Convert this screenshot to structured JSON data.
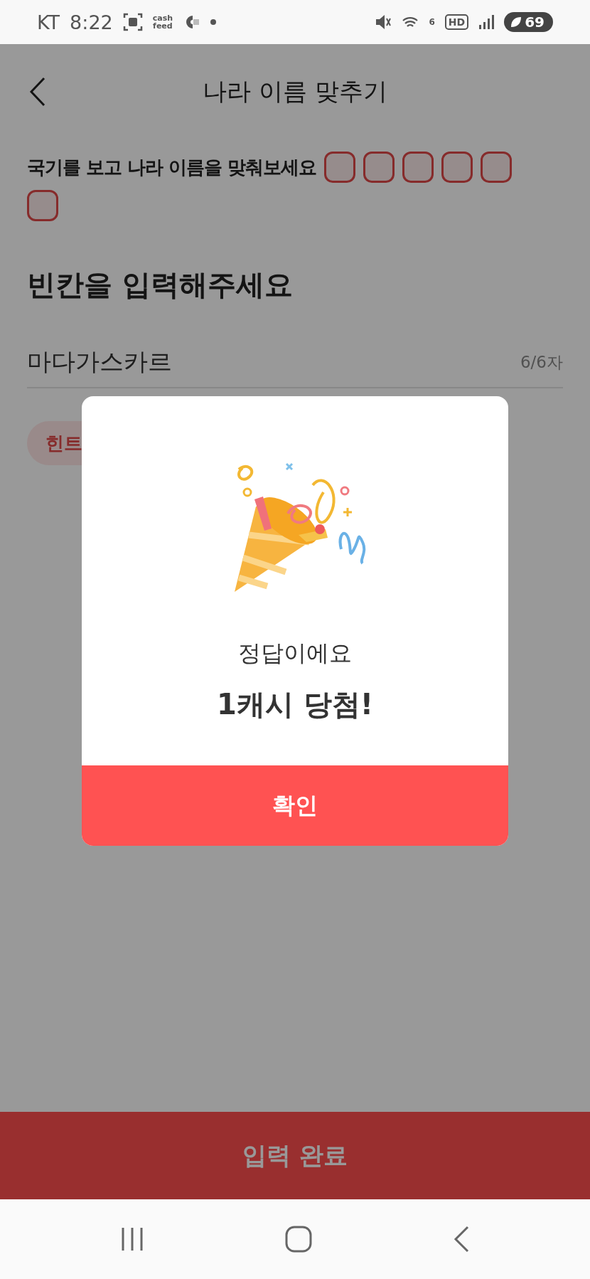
{
  "status_bar": {
    "carrier": "KT",
    "time": "8:22",
    "app_badge_lines": [
      "cash",
      "feed"
    ],
    "wifi_label": "6",
    "hd_label": "HD",
    "battery": "69"
  },
  "app_bar": {
    "title": "나라 이름 맞추기"
  },
  "question": {
    "text": "국기를 보고 나라 이름을 맞춰보세요",
    "answer_slots": [
      {
        "filled": false
      },
      {
        "filled": false
      },
      {
        "filled": false
      },
      {
        "filled": false
      },
      {
        "filled": false
      },
      {
        "filled": false
      }
    ]
  },
  "heading": "빈칸을 입력해주세요",
  "answer_field": {
    "value": "마다가스카르",
    "counter": "6/6자"
  },
  "hint_button": {
    "label": "힌트"
  },
  "submit_button": {
    "label": "입력 완료",
    "disabled": false
  },
  "dialog": {
    "message": "정답이에요",
    "reward": "1캐시 당첨!",
    "confirm": "확인"
  }
}
